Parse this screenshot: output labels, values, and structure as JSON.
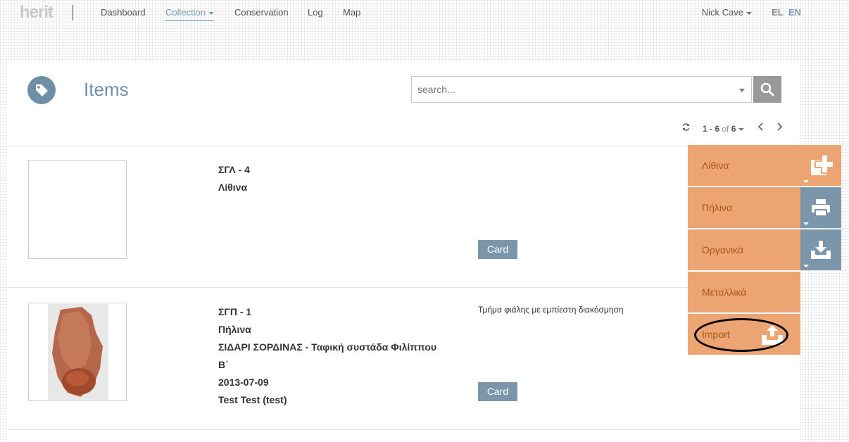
{
  "nav": {
    "logo": "herit",
    "items": [
      "Dashboard",
      "Collection",
      "Conservation",
      "Log",
      "Map"
    ],
    "user": "Nick Cave",
    "lang_el": "EL",
    "lang_en": "EN"
  },
  "page": {
    "title": "Items",
    "search_placeholder": "search...",
    "pager": {
      "range": "1 - 6",
      "of": "of",
      "total": "6"
    }
  },
  "items": [
    {
      "code": "ΣΓΛ - 4",
      "category": "Λίθινα",
      "card": "Card"
    },
    {
      "code": "ΣΓΠ - 1",
      "category": "Πήλινα",
      "site_line1": "ΣΙΔΑΡΙ ΣΟΡΔΙΝΑΣ - Ταφική συστάδα Φιλίππου",
      "site_line2": "Β΄",
      "date": "2013-07-09",
      "user": "Test Test (test)",
      "description": "Τμήμα φιάλης με εμπίεστη διακόσμηση",
      "card": "Card"
    }
  ],
  "side_menu": [
    "Λίθινα",
    "Πήλινα",
    "Οργανικά",
    "Μεταλλικά",
    "Import"
  ],
  "colors": {
    "accent": "#7b9cb4",
    "menu_orange": "#eda473",
    "menu_blue": "#7b95ab"
  }
}
